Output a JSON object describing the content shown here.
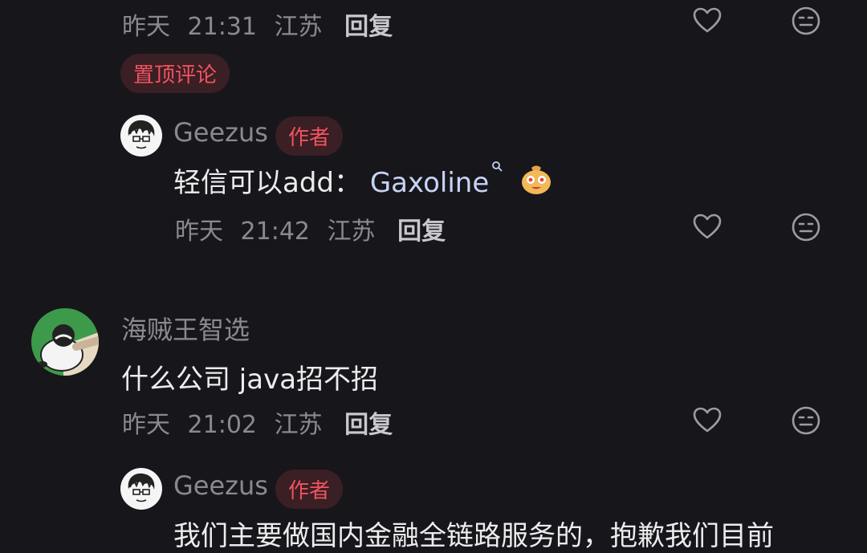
{
  "comment1": {
    "date": "昨天",
    "time": "21:31",
    "location": "江苏",
    "reply_label": "回复",
    "pinned_label": "置顶评论"
  },
  "reply1": {
    "username": "Geezus",
    "author_badge": "作者",
    "text_prefix": "轻信可以add：",
    "search_term": "Gaxoline",
    "search_icon": "search-icon",
    "emoji": "money-bag-emoji",
    "date": "昨天",
    "time": "21:42",
    "location": "江苏",
    "reply_label": "回复"
  },
  "comment2": {
    "username": "海贼王智选",
    "text": "什么公司 java招不招",
    "date": "昨天",
    "time": "21:02",
    "location": "江苏",
    "reply_label": "回复"
  },
  "reply2": {
    "username": "Geezus",
    "author_badge": "作者",
    "text": "我们主要做国内金融全链路服务的，抱歉我们目前"
  },
  "colors": {
    "background": "#17161b",
    "badge_bg": "#3a1f24",
    "badge_text": "#f0535f",
    "meta_text": "#8a8990",
    "link_text": "#c6d4f5"
  },
  "icons": [
    "heart-icon",
    "neutral-face-icon"
  ]
}
